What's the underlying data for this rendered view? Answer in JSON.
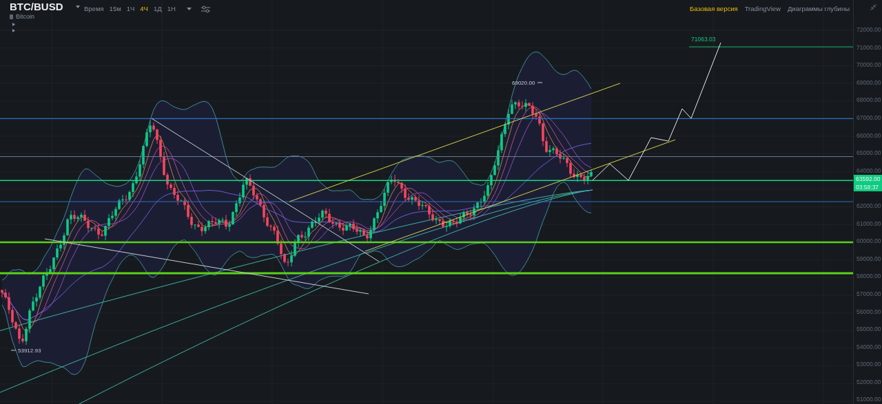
{
  "header": {
    "symbol": "BTC/BUSD",
    "name": "Bitcoin",
    "time_label": "Время",
    "intervals": [
      {
        "label": "15м",
        "selected": false
      },
      {
        "label": "1Ч",
        "selected": false
      },
      {
        "label": "4Ч",
        "selected": true
      },
      {
        "label": "1Д",
        "selected": false
      },
      {
        "label": "1Н",
        "selected": false
      }
    ]
  },
  "views": [
    {
      "label": "Базовая версия",
      "selected": true
    },
    {
      "label": "TradingView",
      "selected": false
    },
    {
      "label": "Диаграммы глубины",
      "selected": false
    }
  ],
  "price_axis": {
    "labels": [
      "72000.00",
      "71000.00",
      "70000.00",
      "69000.00",
      "68000.00",
      "67000.00",
      "66000.00",
      "65000.00",
      "64000.00",
      "62000.00",
      "61000.00",
      "60000.00",
      "59000.00",
      "58000.00",
      "57000.00",
      "56000.00",
      "55000.00",
      "54000.00",
      "53000.00",
      "52000.00",
      "51000.00"
    ]
  },
  "price_tag": {
    "price": "63592.00",
    "countdown": "03:58:37"
  },
  "chart_labels": {
    "high": "69020.00",
    "low": "53912.93",
    "target": "71063.03"
  }
}
